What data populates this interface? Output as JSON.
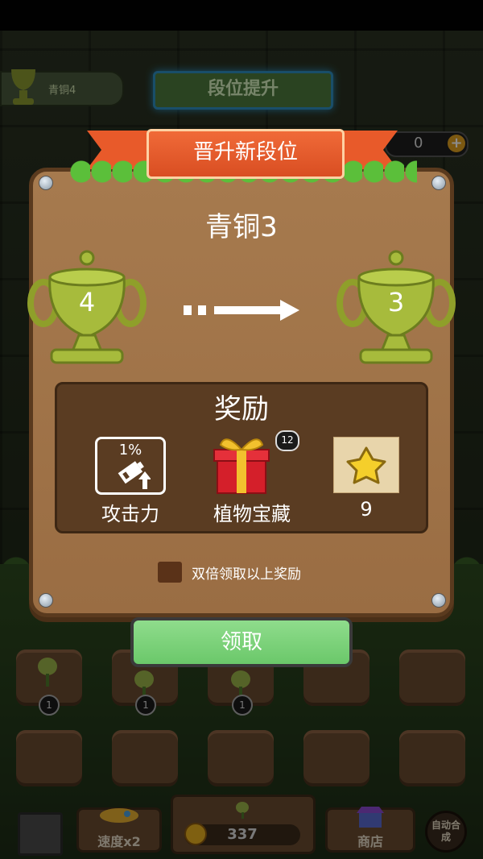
{
  "background": {
    "rank_top_label": "青铜4",
    "rank_up_banner": "段位提升",
    "coins_top": "0",
    "coins_bottom": "337",
    "plot_level": "1",
    "speed_button": "速度x2",
    "shop_button": "商店",
    "auto_button": "自动合成"
  },
  "dialog": {
    "ribbon_title": "晋升新段位",
    "rank_name": "青铜3",
    "from_level": "4",
    "to_level": "3",
    "reward_title": "奖励",
    "rewards": [
      {
        "label": "攻击力",
        "detail": "1%",
        "icon": "attack-boost-icon"
      },
      {
        "label": "植物宝藏",
        "badge": "12",
        "icon": "gift-box-icon"
      },
      {
        "label": "9",
        "icon": "star-icon"
      }
    ],
    "double_label": "双倍领取以上奖励",
    "claim_button": "领取"
  },
  "colors": {
    "wood": "#a67a4e",
    "ribbon": "#e85a2a",
    "claim": "#7ed27b",
    "trophy": "#a7bb3c"
  }
}
